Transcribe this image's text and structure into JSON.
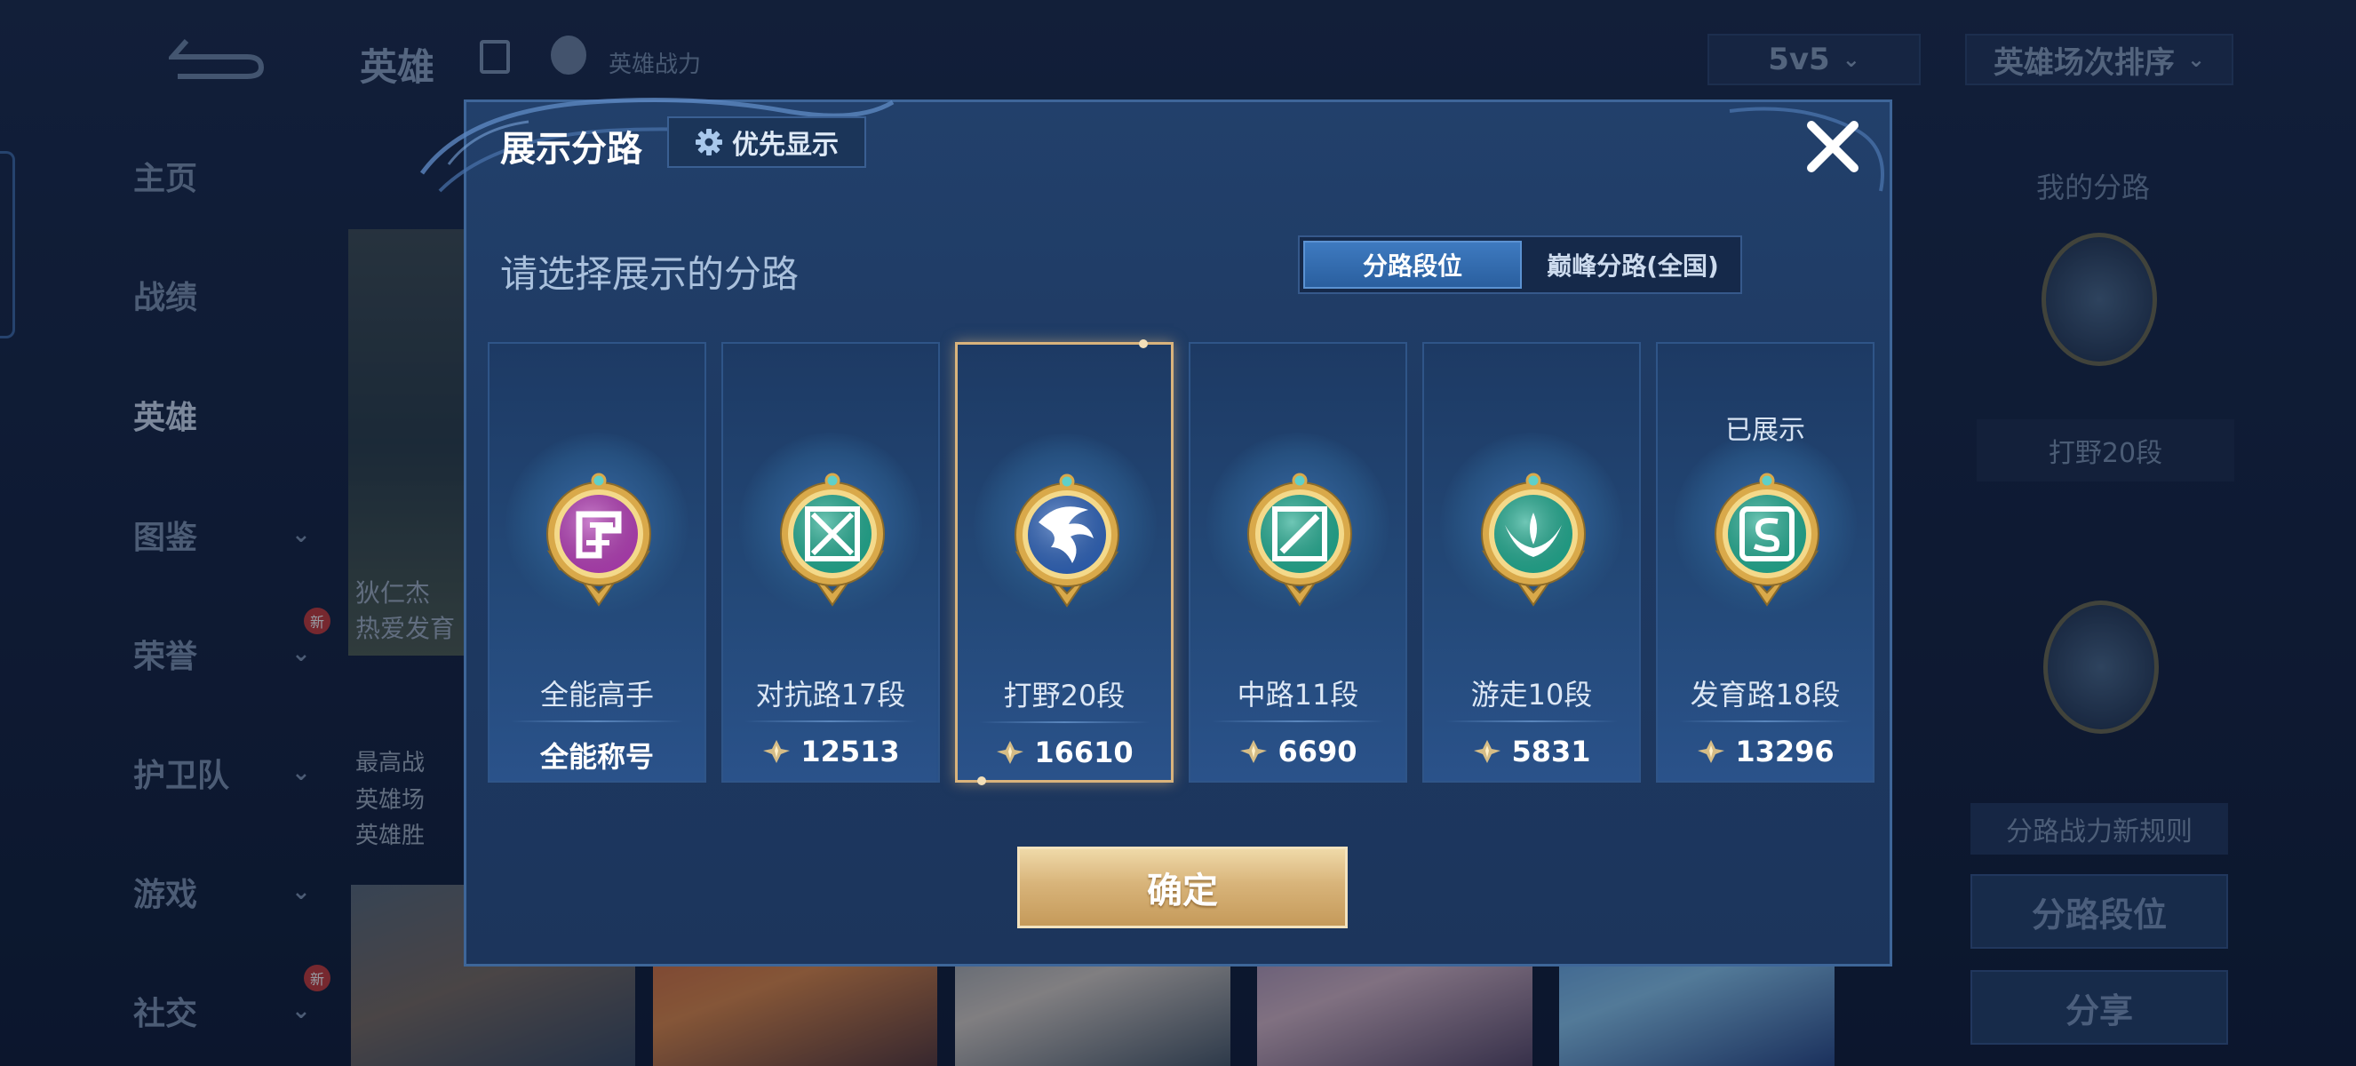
{
  "background": {
    "header_title": "英雄",
    "hero_power_label": "英雄战力",
    "mode_select": "5v5",
    "sort_select": "英雄场次排序",
    "nav": [
      {
        "label": "主页",
        "has_chevron": false,
        "badge": ""
      },
      {
        "label": "战绩",
        "has_chevron": false,
        "badge": ""
      },
      {
        "label": "英雄",
        "has_chevron": false,
        "badge": "",
        "active": true
      },
      {
        "label": "图鉴",
        "has_chevron": true,
        "badge": ""
      },
      {
        "label": "荣誉",
        "has_chevron": true,
        "badge": "新"
      },
      {
        "label": "护卫队",
        "has_chevron": true,
        "badge": ""
      },
      {
        "label": "游戏",
        "has_chevron": true,
        "badge": ""
      },
      {
        "label": "社交",
        "has_chevron": true,
        "badge": "新"
      }
    ],
    "hero_card_lines": [
      "狄仁杰",
      "热爱发育",
      "最高战",
      "英雄场",
      "英雄胜"
    ],
    "right_panel": {
      "title": "我的分路",
      "current_lane": "打野20段",
      "rules_link": "分路战力新规则",
      "lane_rank_button": "分路段位",
      "share_button": "分享"
    }
  },
  "modal": {
    "title": "展示分路",
    "priority_button": "优先显示",
    "subtitle": "请选择展示的分路",
    "tabs": [
      {
        "label": "分路段位",
        "active": true
      },
      {
        "label": "巅峰分路(全国)",
        "active": false
      }
    ],
    "cards": [
      {
        "name": "全能高手",
        "value": "全能称号",
        "value_type": "title",
        "shown_label": "",
        "selected": false,
        "emblem": "all-round-emblem",
        "emblem_color": "#b23fb5"
      },
      {
        "name": "对抗路17段",
        "value": "12513",
        "value_type": "score",
        "shown_label": "",
        "selected": false,
        "emblem": "clash-lane-emblem",
        "emblem_color": "#22a98f"
      },
      {
        "name": "打野20段",
        "value": "16610",
        "value_type": "score",
        "shown_label": "",
        "selected": true,
        "emblem": "jungle-emblem",
        "emblem_color": "#2f63b8"
      },
      {
        "name": "中路11段",
        "value": "6690",
        "value_type": "score",
        "shown_label": "",
        "selected": false,
        "emblem": "mid-lane-emblem",
        "emblem_color": "#22a98f"
      },
      {
        "name": "游走10段",
        "value": "5831",
        "value_type": "score",
        "shown_label": "",
        "selected": false,
        "emblem": "roam-emblem",
        "emblem_color": "#22a98f"
      },
      {
        "name": "发育路18段",
        "value": "13296",
        "value_type": "score",
        "shown_label": "已展示",
        "selected": false,
        "emblem": "farm-lane-emblem",
        "emblem_color": "#22a98f"
      }
    ],
    "confirm_button": "确定"
  }
}
